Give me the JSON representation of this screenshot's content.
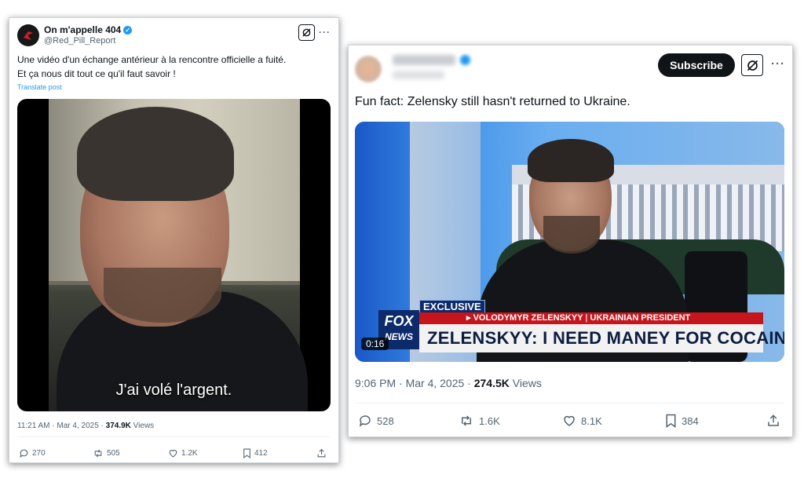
{
  "tweet1": {
    "display_name": "On m'appelle 404",
    "handle": "@Red_Pill_Report",
    "text_line1": "Une vidéo d'un échange antérieur à la rencontre officielle a fuité.",
    "text_line2": "Et ça nous dit tout ce qu'il faut savoir !",
    "translate": "Translate post",
    "subtitle": "J'ai volé l'argent.",
    "meta_time": "11:21 AM · Mar 4, 2025 · ",
    "views_count": "374.9K",
    "views_label": " Views",
    "actions": {
      "replies": "270",
      "reposts": "505",
      "likes": "1.2K",
      "bookmarks": "412"
    },
    "more": "···"
  },
  "tweet2": {
    "subscribe": "Subscribe",
    "text": "Fun fact: Zelensky still hasn't returned to Ukraine.",
    "lower_third": {
      "tag": "EXCLUSIVE",
      "name_line": "▸ VOLODYMYR ZELENSKYY",
      "separator": " | ",
      "title_line": "UKRAINIAN PRESIDENT",
      "headline": "ZELENSKYY: I NEED MANEY FOR COCAINE",
      "logo_top": "FOX",
      "logo_bottom": "NEWS"
    },
    "video_time": "0:16",
    "meta_time": "9:06 PM · Mar 4, 2025 · ",
    "views_count": "274.5K",
    "views_label": " Views",
    "actions": {
      "replies": "528",
      "reposts": "1.6K",
      "likes": "8.1K",
      "bookmarks": "384"
    },
    "more": "···"
  },
  "colors": {
    "accent": "#1d9bf0",
    "muted": "#536471",
    "fox_red": "#c4161c",
    "fox_navy": "#0d2a6b"
  }
}
